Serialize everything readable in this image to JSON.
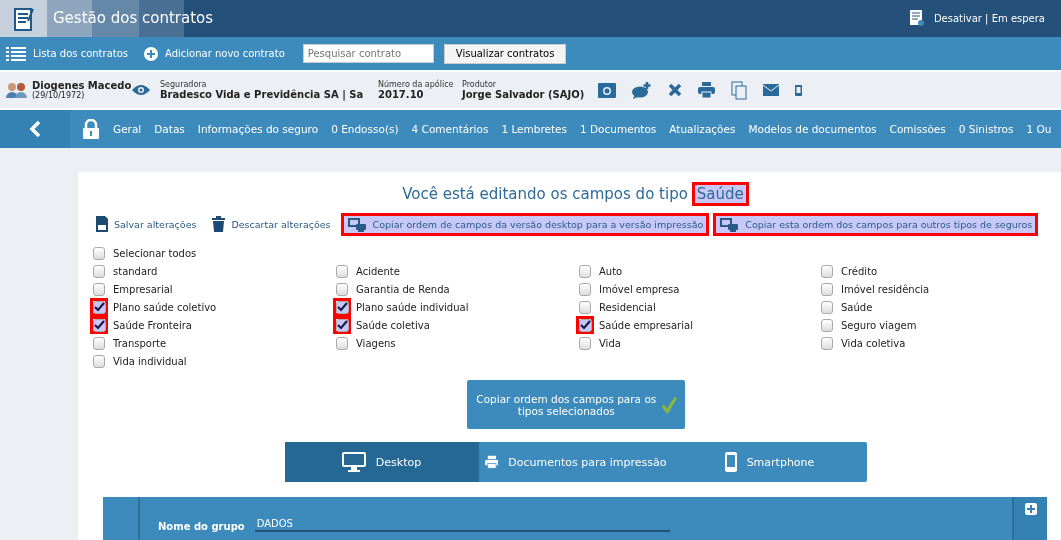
{
  "header": {
    "title": "Gestão dos contratos",
    "status": "Desativar | Em espera"
  },
  "toolbar": {
    "list_link": "Lista dos contratos",
    "add_link": "Adicionar novo contrato",
    "search": {
      "placeholder": "Pesquisar contrato"
    },
    "view_button": "Visualizar contratos"
  },
  "contract": {
    "client_name": "Diogenes Macedo",
    "client_birth": "(29/10/1972)",
    "fields": [
      {
        "label": "Seguradora",
        "value": "Bradesco Vida e Previdência SA | Sa"
      },
      {
        "label": "Número da apólice",
        "value": "2017.10"
      },
      {
        "label": "Produtor",
        "value": "Jorge Salvador (SAJO)"
      }
    ]
  },
  "nav": {
    "items": [
      "Geral",
      "Datas",
      "Informações do seguro",
      "0 Endosso(s)",
      "4 Comentários",
      "1 Lembretes",
      "1 Documentos",
      "Atualizações",
      "Modelos de documentos",
      "Comissões",
      "0 Sinistros",
      "1 Ou"
    ]
  },
  "editor": {
    "heading": "Você está editando os campos do tipo",
    "type_name": "Saúde",
    "type_highlighted": true,
    "actions": [
      {
        "kind": "save",
        "label": "Salvar alterações",
        "highlighted": false
      },
      {
        "kind": "discard",
        "label": "Descartar alterações",
        "highlighted": false
      },
      {
        "kind": "copy",
        "label": "Copiar ordem de campos da versão desktop para a versão impressão",
        "highlighted": true
      },
      {
        "kind": "copy",
        "label": "Copiar esta ordem dos campos para outros tipos de seguros",
        "highlighted": true
      }
    ],
    "select_all": {
      "label": "Selecionar todos",
      "checked": false,
      "highlighted": false
    },
    "columns": [
      [
        {
          "label": "standard",
          "checked": false,
          "highlighted": false
        },
        {
          "label": "Empresarial",
          "checked": false,
          "highlighted": false
        },
        {
          "label": "Plano saúde coletivo",
          "checked": true,
          "highlighted": true
        },
        {
          "label": "Saúde Fronteira",
          "checked": true,
          "highlighted": true
        },
        {
          "label": "Transporte",
          "checked": false,
          "highlighted": false
        },
        {
          "label": "Vida individual",
          "checked": false,
          "highlighted": false
        }
      ],
      [
        {
          "label": "Acidente",
          "checked": false,
          "highlighted": false
        },
        {
          "label": "Garantia de Renda",
          "checked": false,
          "highlighted": false
        },
        {
          "label": "Plano saúde individual",
          "checked": true,
          "highlighted": true
        },
        {
          "label": "Saúde coletiva",
          "checked": true,
          "highlighted": true
        },
        {
          "label": "Viagens",
          "checked": false,
          "highlighted": false
        }
      ],
      [
        {
          "label": "Auto",
          "checked": false,
          "highlighted": false
        },
        {
          "label": "Imóvel empresa",
          "checked": false,
          "highlighted": false
        },
        {
          "label": "Residencial",
          "checked": false,
          "highlighted": false
        },
        {
          "label": "Saúde empresarial",
          "checked": true,
          "highlighted": true
        },
        {
          "label": "Vida",
          "checked": false,
          "highlighted": false
        }
      ],
      [
        {
          "label": "Crédito",
          "checked": false,
          "highlighted": false
        },
        {
          "label": "Imóvel residência",
          "checked": false,
          "highlighted": false
        },
        {
          "label": "Saúde",
          "checked": false,
          "highlighted": false
        },
        {
          "label": "Seguro viagem",
          "checked": false,
          "highlighted": false
        },
        {
          "label": "Vida coletiva",
          "checked": false,
          "highlighted": false
        }
      ]
    ],
    "copy_button": "Copiar ordem dos campos para os tipos selecionados",
    "views": [
      {
        "kind": "desktop",
        "label": "Desktop",
        "selected": true
      },
      {
        "kind": "print",
        "label": "Documentos para impressão",
        "selected": false
      },
      {
        "kind": "phone",
        "label": "Smartphone",
        "selected": false
      }
    ],
    "group": {
      "label": "Nome do grupo",
      "value": "DADOS"
    }
  }
}
